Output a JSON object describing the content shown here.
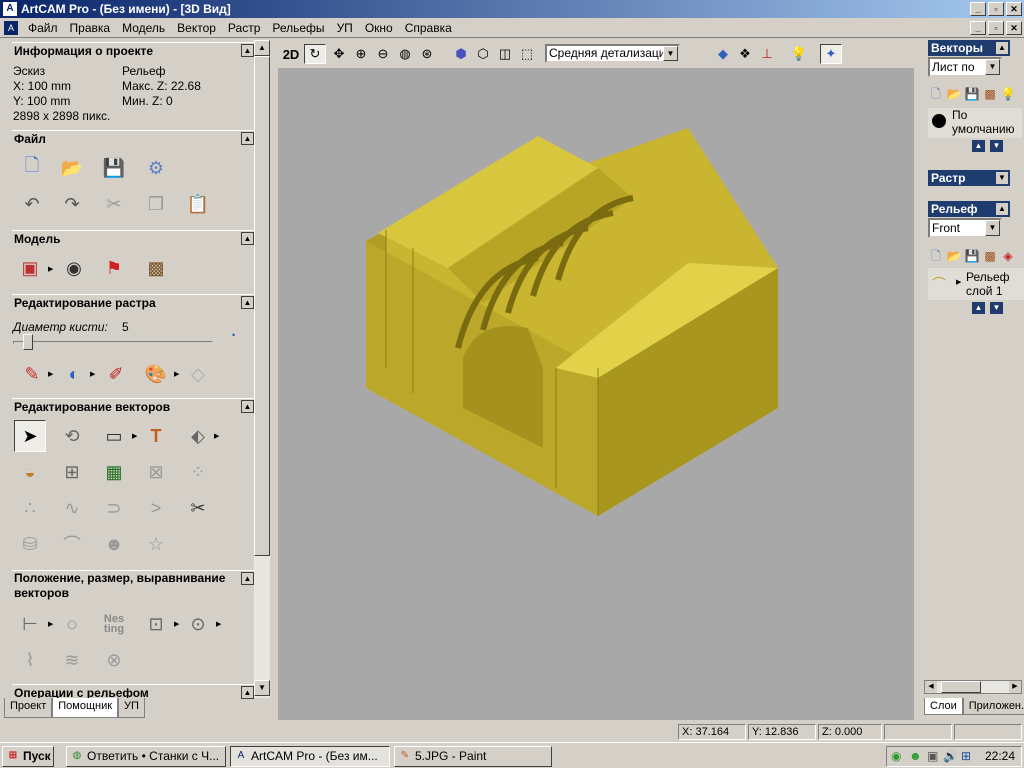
{
  "window": {
    "title": "ArtCAM Pro - (Без имени) - [3D Вид]"
  },
  "menu": [
    "Файл",
    "Правка",
    "Модель",
    "Вектор",
    "Растр",
    "Рельефы",
    "УП",
    "Окно",
    "Справка"
  ],
  "left": {
    "project_info": {
      "title": "Информация о проекте",
      "sketch_label": "Эскиз",
      "relief_label": "Рельеф",
      "x": "X: 100 mm",
      "y": "Y: 100 mm",
      "pixels": "2898 x 2898 пикс.",
      "max_z": "Макс. Z: 22.68",
      "min_z": "Мин. Z: 0"
    },
    "file": {
      "title": "Файл"
    },
    "model": {
      "title": "Модель"
    },
    "raster_edit": {
      "title": "Редактирование растра",
      "brush_label": "Диаметр кисти:",
      "brush_value": "5",
      "brush_level": 0.05
    },
    "vector_edit": {
      "title": "Редактирование векторов"
    },
    "position": {
      "title_line1": "Положение, размер, выравнивание",
      "title_line2": "векторов",
      "nesting": "Nes ting"
    },
    "relief_ops": {
      "title": "Операции с рельефом"
    },
    "tabs": [
      "Проект",
      "Помощник",
      "УП"
    ]
  },
  "toolbar": {
    "mode": "2D",
    "detail": "Средняя детализация"
  },
  "right": {
    "vectors": {
      "title": "Векторы",
      "combo": "Лист по",
      "layer": "По умолчанию"
    },
    "raster": {
      "title": "Растр"
    },
    "relief": {
      "title": "Рельеф",
      "combo": "Front",
      "layer_line1": "Рельеф",
      "layer_line2": "слой 1"
    },
    "tabs": [
      "Слои",
      "Приложен."
    ]
  },
  "status": {
    "x": "X: 37.164",
    "y": "Y: 12.836",
    "z": "Z: 0.000"
  },
  "taskbar": {
    "start": "Пуск",
    "tasks": [
      "Ответить • Станки с Ч...",
      "ArtCAM Pro - (Без им...",
      "5.JPG - Paint"
    ],
    "time": "22:24"
  },
  "colors": {
    "relief": "#c9b530",
    "relief_dark": "#8f7e16",
    "relief_light": "#e2d24a",
    "viewport": "#a8a8a8",
    "panel_head": "#1e3c6e"
  }
}
